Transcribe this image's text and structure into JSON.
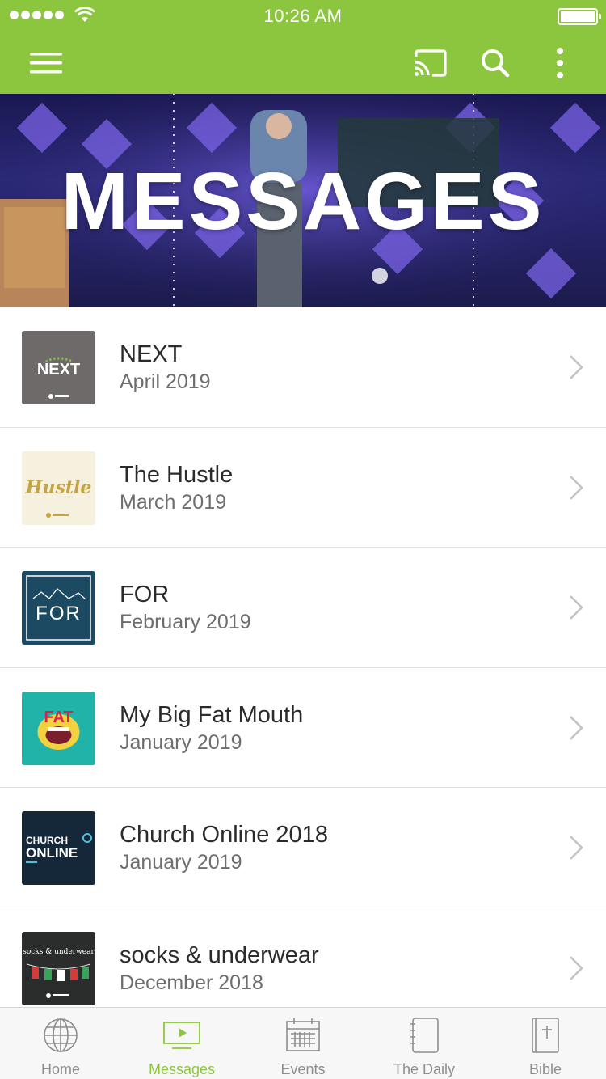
{
  "status_bar": {
    "time": "10:26 AM"
  },
  "app_bar": {
    "menu_icon": "hamburger-menu-icon",
    "cast_icon": "cast-icon",
    "search_icon": "search-icon",
    "more_icon": "more-vertical-icon"
  },
  "hero": {
    "title": "MESSAGES"
  },
  "messages": [
    {
      "title": "NEXT",
      "date": "April 2019",
      "thumb_text": "NEXT"
    },
    {
      "title": "The Hustle",
      "date": "March 2019",
      "thumb_text": "Hustle"
    },
    {
      "title": "FOR",
      "date": "February 2019",
      "thumb_text": "FOR"
    },
    {
      "title": "My Big Fat Mouth",
      "date": "January 2019",
      "thumb_text": "FAT"
    },
    {
      "title": "Church Online 2018",
      "date": "January 2019",
      "thumb_text_1": "CHURCH",
      "thumb_text_2": "ONLINE"
    },
    {
      "title": "socks & underwear",
      "date": "December 2018",
      "thumb_text": "socks & underwear"
    }
  ],
  "tabs": [
    {
      "label": "Home",
      "icon": "globe-icon"
    },
    {
      "label": "Messages",
      "icon": "play-video-icon"
    },
    {
      "label": "Events",
      "icon": "calendar-icon"
    },
    {
      "label": "The Daily",
      "icon": "notebook-icon"
    },
    {
      "label": "Bible",
      "icon": "bible-icon"
    }
  ],
  "colors": {
    "brand_green": "#8cc63f",
    "text_primary": "#2b2b2b",
    "text_secondary": "#6e6e6e",
    "tab_inactive": "#8e8e8e"
  }
}
